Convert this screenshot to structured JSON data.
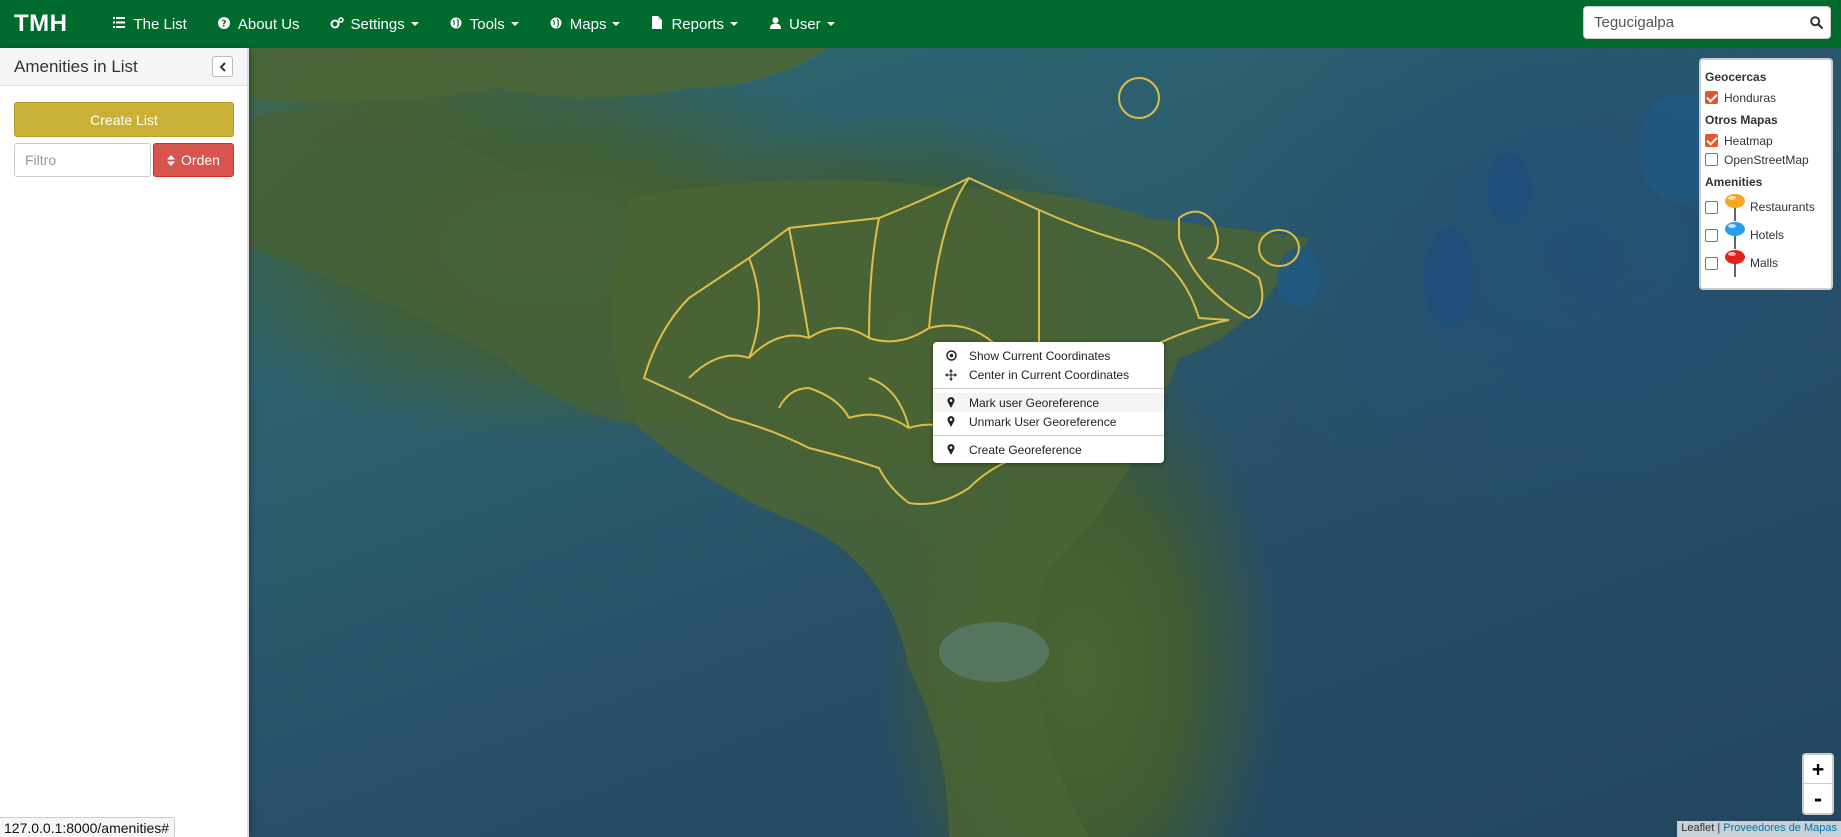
{
  "navbar": {
    "brand": "TMH",
    "items": [
      {
        "label": "The List",
        "icon": "list-icon",
        "dropdown": false
      },
      {
        "label": "About Us",
        "icon": "question-circle-icon",
        "dropdown": false
      },
      {
        "label": "Settings",
        "icon": "cogs-icon",
        "dropdown": true
      },
      {
        "label": "Tools",
        "icon": "globe-icon",
        "dropdown": true
      },
      {
        "label": "Maps",
        "icon": "globe-icon",
        "dropdown": true
      },
      {
        "label": "Reports",
        "icon": "file-icon",
        "dropdown": true
      },
      {
        "label": "User",
        "icon": "user-icon",
        "dropdown": true
      }
    ],
    "search": {
      "value": "Tegucigalpa",
      "icon": "search-icon"
    },
    "color": "#006b2d"
  },
  "sidebar": {
    "title": "Amenities in List",
    "create_button": "Create List",
    "filter_placeholder": "Filtro",
    "order_button": "Orden",
    "status_url": "127.0.0.1:8000/amenities#"
  },
  "layers": {
    "sections": [
      {
        "title": "Geocercas",
        "items": [
          {
            "label": "Honduras",
            "checked": true
          }
        ]
      },
      {
        "title": "Otros Mapas",
        "items": [
          {
            "label": "Heatmap",
            "checked": true
          },
          {
            "label": "OpenStreetMap",
            "checked": false
          }
        ]
      },
      {
        "title": "Amenities",
        "items": [
          {
            "label": "Restaurants",
            "checked": false,
            "pin_color": "#f5a623"
          },
          {
            "label": "Hotels",
            "checked": false,
            "pin_color": "#2a9ee8"
          },
          {
            "label": "Malls",
            "checked": false,
            "pin_color": "#e2231a"
          }
        ]
      }
    ]
  },
  "context_menu": {
    "items": [
      {
        "label": "Show Current Coordinates",
        "icon": "target-icon"
      },
      {
        "label": "Center in Current Coordinates",
        "icon": "move-icon"
      },
      {
        "label": "Mark user Georeference",
        "icon": "map-marker-icon"
      },
      {
        "label": "Unmark User Georeference",
        "icon": "map-marker-icon"
      },
      {
        "label": "Create Georeference",
        "icon": "map-marker-icon"
      }
    ]
  },
  "zoom": {
    "in": "+",
    "out": "-"
  },
  "attribution": {
    "leaflet": "Leaflet",
    "separator": " | ",
    "provider": "Proveedores de Mapas"
  }
}
